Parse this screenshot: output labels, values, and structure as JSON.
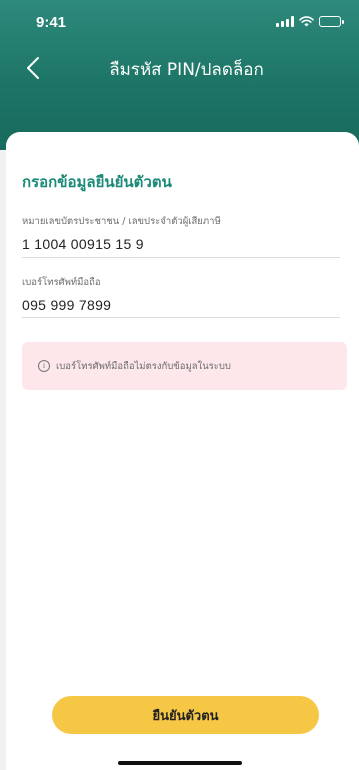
{
  "status_bar": {
    "time": "9:41",
    "icons": [
      "signal-icon",
      "wifi-icon",
      "battery-icon"
    ]
  },
  "nav": {
    "back_icon": "chevron-left-icon",
    "title": "ลืมรหัส PIN/ปลดล็อก"
  },
  "form": {
    "section_title": "กรอกข้อมูลยืนยันตัวตน",
    "id_field": {
      "label": "หมายเลขบัตรประชาชน / เลขประจำตัวผู้เสียภาษี",
      "value": "1 1004 00915 15 9"
    },
    "phone_field": {
      "label": "เบอร์โทรศัพท์มือถือ",
      "value": "095 999 7899"
    }
  },
  "alert": {
    "icon": "info-icon",
    "message": "เบอร์โทรศัพท์มือถือไม่ตรงกับข้อมูลในระบบ"
  },
  "confirm_button": {
    "label": "ยืนยันตัวตน"
  },
  "colors": {
    "header_top": "#2e8a7c",
    "header_bottom": "#176a5c",
    "accent": "#1b8a78",
    "alert_bg": "#fde7ea",
    "button_bg": "#f6c745"
  }
}
